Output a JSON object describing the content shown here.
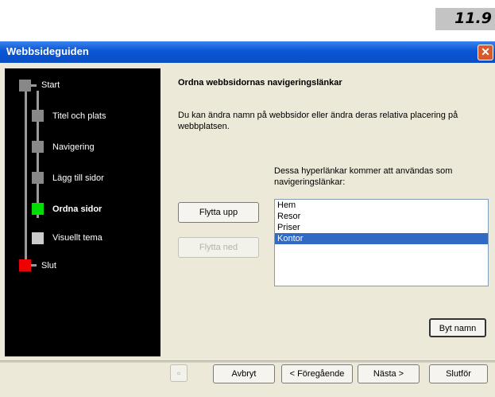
{
  "page_number": "11.9",
  "window": {
    "title": "Webbsideguiden",
    "close_glyph": "✕"
  },
  "steps": [
    {
      "label": "Start",
      "box_color": "#888888"
    },
    {
      "label": "Titel och plats",
      "box_color": "#888888"
    },
    {
      "label": "Navigering",
      "box_color": "#888888"
    },
    {
      "label": "Lägg till sidor",
      "box_color": "#888888"
    },
    {
      "label": "Ordna sidor",
      "box_color": "#00dd00",
      "current": true
    },
    {
      "label": "Visuellt tema",
      "box_color": "#cccccc"
    },
    {
      "label": "Slut",
      "box_color": "#ee0000"
    }
  ],
  "content": {
    "heading": "Ordna webbsidornas navigeringslänkar",
    "description": "Du kan ändra namn på webbsidor eller ändra deras relativa placering på webbplatsen.",
    "list_caption": "Dessa hyperlänkar kommer att användas som navigeringslänkar:",
    "list_items": [
      "Hem",
      "Resor",
      "Priser",
      "Kontor"
    ],
    "selected_index": 3,
    "move_up_label": "Flytta upp",
    "move_down_label": "Flytta ned",
    "rename_label": "Byt namn"
  },
  "footer": {
    "help_icon": "help-icon",
    "cancel_label": "Avbryt",
    "back_label": "< Föregående",
    "next_label": "Nästa >",
    "finish_label": "Slutför"
  }
}
